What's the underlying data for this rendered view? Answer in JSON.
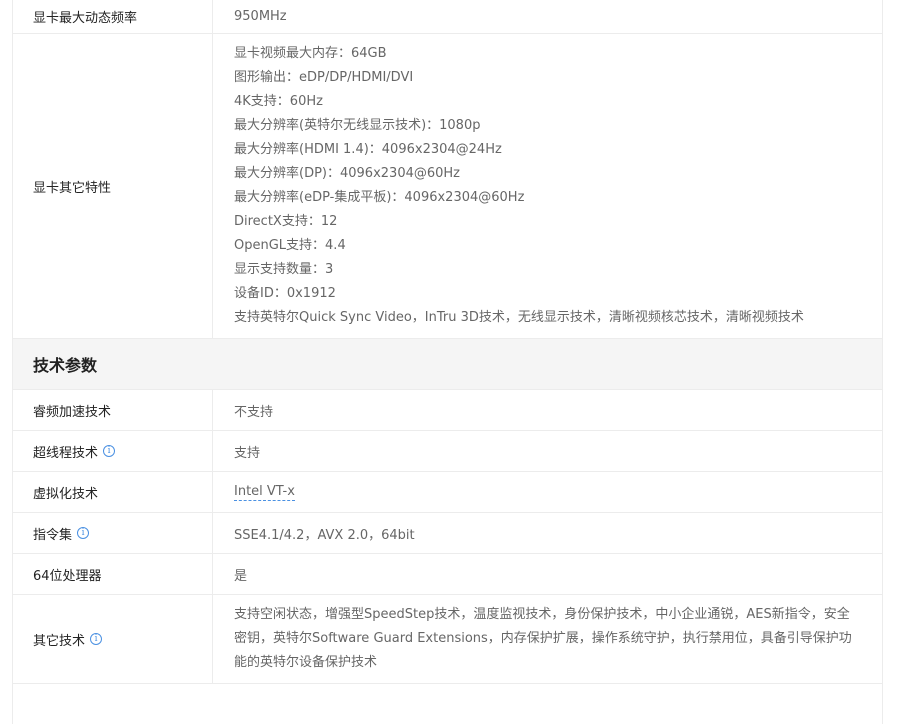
{
  "rows_top": [
    {
      "label": "显卡最大动态频率",
      "value": "950MHz"
    }
  ],
  "gpu_other": {
    "label": "显卡其它特性",
    "lines": [
      "显卡视频最大内存：64GB",
      "图形输出：eDP/DP/HDMI/DVI",
      "4K支持：60Hz",
      "最大分辨率(英特尔无线显示技术)：1080p",
      "最大分辨率(HDMI 1.4)：4096x2304@24Hz",
      "最大分辨率(DP)：4096x2304@60Hz",
      "最大分辨率(eDP-集成平板)：4096x2304@60Hz",
      "DirectX支持：12",
      "OpenGL支持：4.4",
      "显示支持数量：3",
      "设备ID：0x1912",
      "支持英特尔Quick Sync Video，InTru 3D技术，无线显示技术，清晰视频核芯技术，清晰视频技术"
    ]
  },
  "section_title": "技术参数",
  "tech": [
    {
      "label": "睿频加速技术",
      "value": "不支持"
    },
    {
      "label": "超线程技术",
      "value": "支持"
    },
    {
      "label": "虚拟化技术",
      "value": "Intel VT-x"
    },
    {
      "label": "指令集",
      "value": "SSE4.1/4.2，AVX 2.0，64bit"
    },
    {
      "label": "64位处理器",
      "value": "是"
    },
    {
      "label": "其它技术",
      "value": "支持空闲状态，增强型SpeedStep技术，温度监视技术，身份保护技术，中小企业通锐，AES新指令，安全密钥，英特尔Software Guard Extensions，内存保护扩展，操作系统守护，执行禁用位，具备引导保护功能的英特尔设备保护技术"
    }
  ],
  "info_glyph": "i"
}
